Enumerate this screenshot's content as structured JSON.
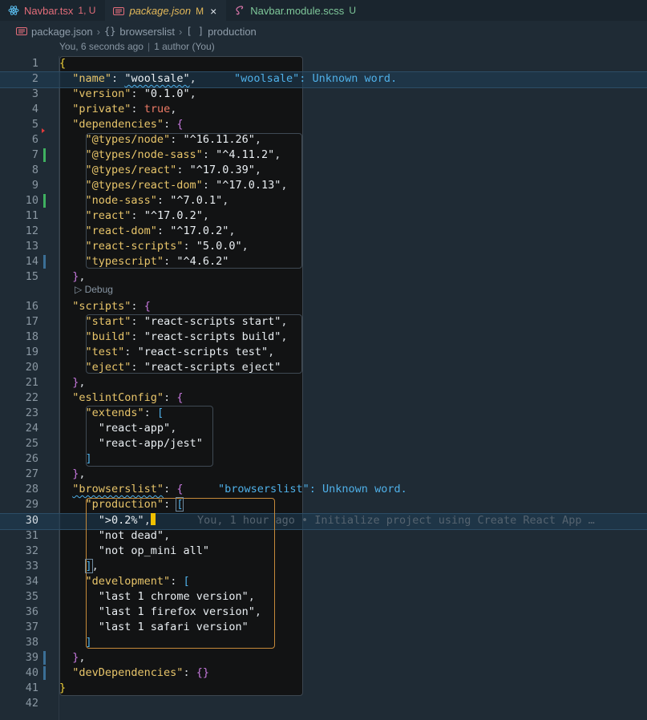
{
  "tabs": [
    {
      "name": "Navbar.tsx",
      "status": "1, U",
      "icon": "react-icon",
      "kind": "err"
    },
    {
      "name": "package.json",
      "status": "M",
      "icon": "json-icon",
      "kind": "mod",
      "active": true,
      "close": "×"
    },
    {
      "name": "Navbar.module.scss",
      "status": "U",
      "icon": "sass-icon",
      "kind": "new"
    }
  ],
  "breadcrumb": {
    "file": "package.json",
    "sep": "›",
    "obj_icon": "{}",
    "obj": "browserslist",
    "arr_icon": "[ ]",
    "arr": "production"
  },
  "lens": {
    "time": "You, 6 seconds ago",
    "bar": "|",
    "authors": "1 author (You)"
  },
  "debug_label": "▷ Debug",
  "diagnostics": {
    "woolsale": "\"woolsale\": Unknown word.",
    "browserslist": "\"browserslist\": Unknown word."
  },
  "blame": "You, 1 hour ago • Initialize project using Create React App …",
  "line_numbers": [
    "1",
    "2",
    "3",
    "4",
    "5",
    "6",
    "7",
    "8",
    "9",
    "10",
    "11",
    "12",
    "13",
    "14",
    "15",
    "16",
    "17",
    "18",
    "19",
    "20",
    "21",
    "22",
    "23",
    "24",
    "25",
    "26",
    "27",
    "28",
    "29",
    "30",
    "31",
    "32",
    "33",
    "34",
    "35",
    "36",
    "37",
    "38",
    "39",
    "40",
    "41",
    "42"
  ],
  "code": {
    "name_key": "\"name\"",
    "name_val": "\"woolsale\"",
    "version_key": "\"version\"",
    "version_val": "\"0.1.0\"",
    "private_key": "\"private\"",
    "private_val": "true",
    "deps_key": "\"dependencies\"",
    "deps": [
      {
        "k": "\"@types/node\"",
        "v": "\"^16.11.26\""
      },
      {
        "k": "\"@types/node-sass\"",
        "v": "\"^4.11.2\""
      },
      {
        "k": "\"@types/react\"",
        "v": "\"^17.0.39\""
      },
      {
        "k": "\"@types/react-dom\"",
        "v": "\"^17.0.13\""
      },
      {
        "k": "\"node-sass\"",
        "v": "\"^7.0.1\""
      },
      {
        "k": "\"react\"",
        "v": "\"^17.0.2\""
      },
      {
        "k": "\"react-dom\"",
        "v": "\"^17.0.2\""
      },
      {
        "k": "\"react-scripts\"",
        "v": "\"5.0.0\""
      },
      {
        "k": "\"typescript\"",
        "v": "\"^4.6.2\""
      }
    ],
    "scripts_key": "\"scripts\"",
    "scripts": [
      {
        "k": "\"start\"",
        "v": "\"react-scripts start\""
      },
      {
        "k": "\"build\"",
        "v": "\"react-scripts build\""
      },
      {
        "k": "\"test\"",
        "v": "\"react-scripts test\""
      },
      {
        "k": "\"eject\"",
        "v": "\"react-scripts eject\""
      }
    ],
    "eslint_key": "\"eslintConfig\"",
    "extends_key": "\"extends\"",
    "extends": [
      "\"react-app\"",
      "\"react-app/jest\""
    ],
    "browsers_key": "\"browserslist\"",
    "prod_key": "\"production\"",
    "prod": [
      "\">0.2%\"",
      "\"not dead\"",
      "\"not op_mini all\""
    ],
    "dev_key": "\"development\"",
    "dev": [
      "\"last 1 chrome version\"",
      "\"last 1 firefox version\"",
      "\"last 1 safari version\""
    ],
    "devdeps_key": "\"devDependencies\"",
    "devdeps_val": "{}"
  }
}
